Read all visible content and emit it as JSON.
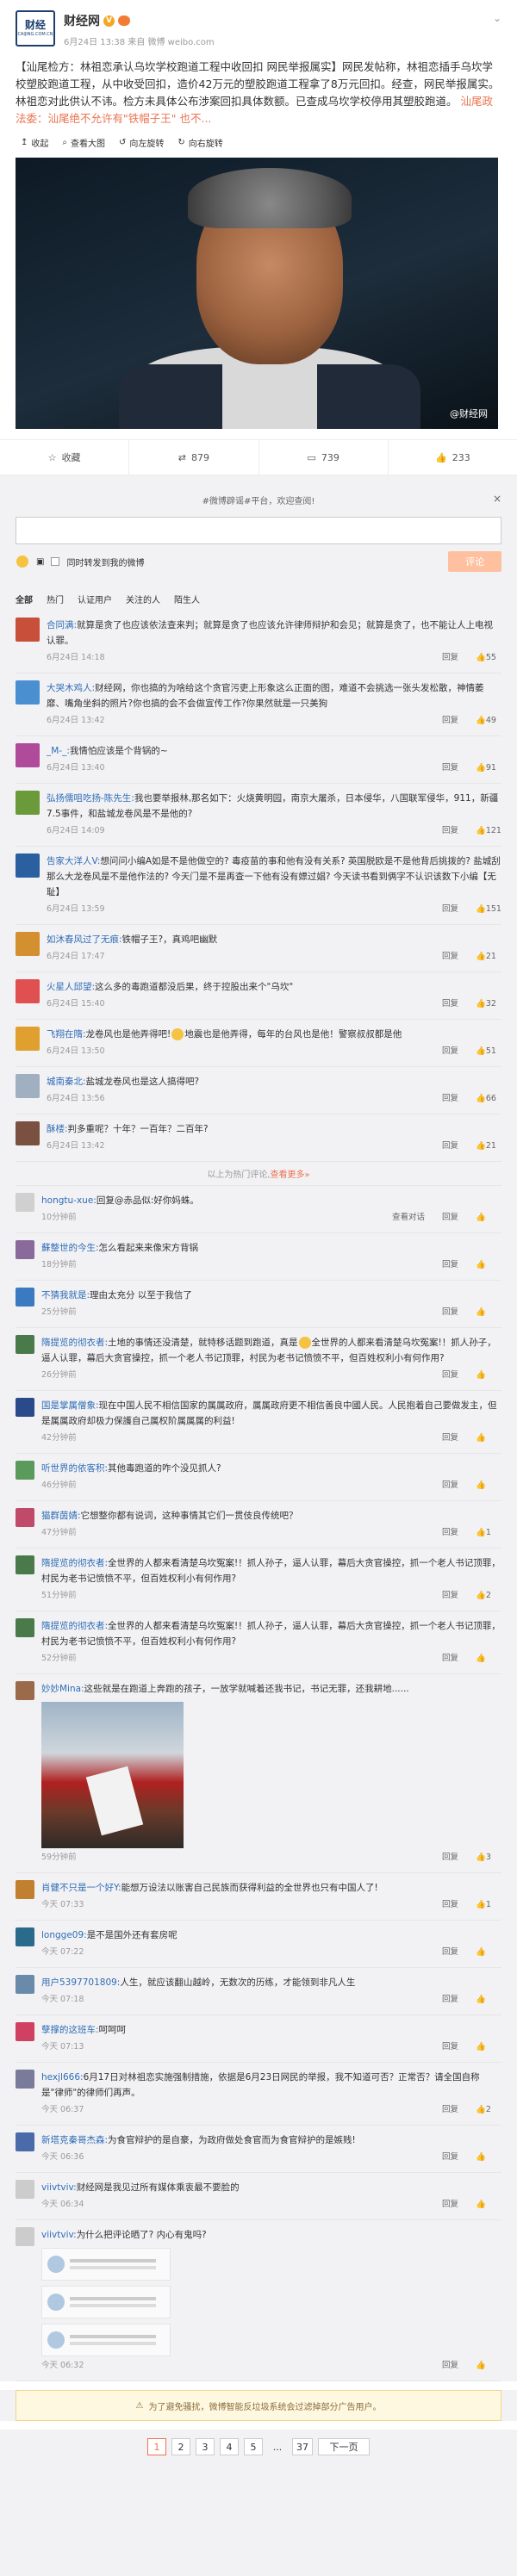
{
  "post": {
    "author": "财经网",
    "logo_line1": "财经",
    "logo_line2": "CAIJING.COM.CN",
    "time": "6月24日 13:38",
    "source": "来自 微博 weibo.com",
    "text_tag": "【汕尾检方：林祖恋承认乌坎学校跑道工程中收回扣 网民举报属实】",
    "text_body": "网民发帖称，林祖恋插手乌坎学校塑胶跑道工程，从中收受回扣，造价42万元的塑胶跑道工程拿了8万元回扣。经查，网民举报属实。林祖恋对此供认不讳。检方未具体公布涉案回扣具体数额。已查成乌坎学校停用其塑胶跑道。",
    "text_link": "汕尾政法委：汕尾绝不允许有\"铁帽子王\"  也不...",
    "tools": [
      "收起",
      "查看大图",
      "向左旋转",
      "向右旋转"
    ],
    "watermark": "@财经网",
    "actions": {
      "favorite": "收藏",
      "repost": "879",
      "comment": "739",
      "like": "233"
    }
  },
  "composer": {
    "hint": "#微博辟谣#平台，欢迎查阅!",
    "also_repost": "同时转发到我的微博",
    "submit": "评论"
  },
  "filter_tabs": [
    "全部",
    "热门",
    "认证用户",
    "关注的人",
    "陌生人"
  ],
  "comments": [
    {
      "name": "合同满:",
      "text": "就算是贪了也应该依法查来判；就算是贪了也应该允许律师辩护和会见；就算是贪了，也不能让人上电视 认罪。",
      "time": "6月24日 14:18",
      "likes": "55",
      "color": "#c8503a"
    },
    {
      "name": "大哭木鸡人:",
      "text": "财经网，你也搞的为啥给这个贪官污吏上形象这么正面的图，难道不会挑选一张头发松散，神情萎靡、嘴角坐斜的照片?你也搞的会不会做宣传工作?你果然就是一只美狗",
      "time": "6月24日 13:42",
      "likes": "49",
      "color": "#4a8fd0"
    },
    {
      "name": "_M-_:",
      "text": "我情怕应该是个背锅的~",
      "time": "6月24日 13:40",
      "likes": "91",
      "color": "#b04a9a"
    },
    {
      "name": "弘扬儒咀吃扬-陈先生:",
      "text": "我也要举报林,那名如下：火烧黄明园，南京大屠杀，日本侵华，八国联军侵华，911，新疆7.5事件，和盐城龙卷风是不是他的?",
      "time": "6月24日 14:09",
      "likes": "121",
      "color": "#6a9a3a"
    },
    {
      "name": "告家大洋人V:",
      "text": "想问问小编A如是不是他做空的? 毒疫苗的事和他有没有关系? 英国脱欧是不是他背后挑拨的? 盐城刮那么大龙卷风是不是他作法的? 今天门是不是再查一下他有没有嫖过娼? 今天读书看到俩字不认识该数下小编【无耻】",
      "time": "6月24日 13:59",
      "likes": "151",
      "color": "#2a5fa0"
    },
    {
      "name": "如沐春风过了无痕:",
      "text": "铁帽子王?，真鸡吧幽默",
      "time": "6月24日 17:47",
      "likes": "21",
      "color": "#d49030"
    },
    {
      "name": "火星人邱望:",
      "text": "这么多的毒跑道都没后果，终于控股出来个\"乌坎\"",
      "time": "6月24日 15:40",
      "likes": "32",
      "color": "#e05050"
    },
    {
      "name": "飞翔在隋:",
      "text": "龙卷风也是他弄得吧!",
      "text2": "地震也是他弄得，每年的台风也是他！警察叔叔都是他",
      "time": "6月24日 13:50",
      "likes": "51",
      "color": "#e0a030"
    },
    {
      "name": "城南秦北:",
      "text": "盐城龙卷风也是这人搞得吧?",
      "time": "6月24日 13:56",
      "likes": "66",
      "color": "#a0b0c0"
    },
    {
      "name": "酥楼:",
      "text": "判多重呢？十年？一百年？二百年?",
      "time": "6月24日 13:42",
      "likes": "21",
      "color": "#7a5040"
    }
  ],
  "more_hot": "以上为热门评论,",
  "more_hot_link": "查看更多»",
  "sub_comments": [
    {
      "name": "hongtu-xue:",
      "text": "回复@赤品似:好你妈蛛。",
      "time": "10分钟前",
      "extra": "查看对话",
      "likes": "",
      "color": "#d0d0d0"
    },
    {
      "name": "蘇整世的今生:",
      "text": "怎么看起来来像宋方背锅",
      "time": "18分钟前",
      "likes": "",
      "color": "#8a6a9a"
    },
    {
      "name": "不猜我就是:",
      "text": "理由太充分 以至于我信了",
      "time": "25分钟前",
      "likes": "",
      "color": "#3a7ac0"
    },
    {
      "name": "隋提览的彻衣者:",
      "text": "土地的事情还没清楚，就特移话题到跑道，真是",
      "text2": "全世界的人都来看清楚乌坎冤案!！抓人孙子，逼人认罪，幕后大贪官操控，抓一个老人书记顶罪，村民为老书记愤愤不平，但百姓权利小有何作用?",
      "time": "26分钟前",
      "likes": "",
      "color": "#4a7a4a"
    },
    {
      "name": "国是掌属僧象:",
      "text": "现在中国人民不相信国家的属属政府，属属政府更不相信善良中國人民。人民抱着自己要做发主，但是属属政府却极力保護自己属权阶属属属的利益!",
      "time": "42分钟前",
      "likes": "",
      "color": "#2a4a8a"
    },
    {
      "name": "听世界的依客积:",
      "text": "其他毒跑道的咋个没见抓人?",
      "time": "46分钟前",
      "likes": "",
      "color": "#5a9a5a"
    },
    {
      "name": "猫群茵婧:",
      "text": "它想整你都有说词，这种事情其它们一贯伎良传统吧？",
      "time": "47分钟前",
      "likes": "1",
      "color": "#c04a6a"
    },
    {
      "name": "隋提览的彻衣者:",
      "text": "全世界的人都来看清楚乌坎冤案!！抓人孙子，逼人认罪，幕后大贪官操控，抓一个老人书记顶罪，村民为老书记愤愤不平，但百姓权利小有何作用?",
      "time": "51分钟前",
      "likes": "2",
      "color": "#4a7a4a"
    },
    {
      "name": "隋提览的彻衣者:",
      "text": "全世界的人都来看清楚乌坎冤案!！抓人孙子，逼人认罪，幕后大贪官操控，抓一个老人书记顶罪，村民为老书记愤愤不平，但百姓权利小有何作用?",
      "time": "52分钟前",
      "likes": "",
      "color": "#4a7a4a"
    },
    {
      "name": "妙妙Mina:",
      "text": "这些就是在跑道上奔跑的孩子，一放学就喊着还我书记，书记无罪，还我耕地......",
      "time": "59分钟前",
      "likes": "3",
      "color": "#9a6a4a",
      "photo": true
    },
    {
      "name": "肖健不只是一个好Y:",
      "text": "能想万设法以账害自己民族而获得利益的全世界也只有中国人了!",
      "time": "今天 07:33",
      "likes": "1",
      "color": "#c08030"
    },
    {
      "name": "longge09:",
      "text": "是不是国外还有套房呢",
      "time": "今天 07:22",
      "likes": "",
      "color": "#2a6a8a"
    },
    {
      "name": "用户5397701809:",
      "text": "人生，就应该翻山越岭，无数次的历练，才能领到非凡人生",
      "time": "今天 07:18",
      "likes": "",
      "color": "#6a8aaa"
    },
    {
      "name": "孽撑的这班车:",
      "text": "呵呵呵",
      "time": "今天 07:13",
      "likes": "",
      "color": "#d04060"
    },
    {
      "name": "hexjl666:",
      "text": "6月17日对林祖恋实施强制措施，依据是6月23日网民的举报，我不知道可否？正常否？请全国自称是\"律师\"的律师们再声。",
      "time": "今天 06:37",
      "likes": "2",
      "color": "#7a7a9a"
    },
    {
      "name": "新塔克秦哥杰森:",
      "text": "为食官辩护的是自豪，为政府做处食官而为食官辩护的是嫉贱!",
      "time": "今天 06:36",
      "likes": "",
      "color": "#4a6aaa"
    },
    {
      "name": "viivtviv:",
      "text": "财经网是我见过所有媒体乘衷最不要脸的",
      "time": "今天 06:34",
      "likes": "",
      "color": "#cccccc"
    },
    {
      "name": "viivtviv:",
      "text": "为什么把评论晒了? 内心有鬼吗?",
      "time": "今天 06:32",
      "likes": "",
      "color": "#cccccc",
      "shots": true
    }
  ],
  "reply_label": "回复",
  "ad_notice": "为了避免骚扰，微博智能反垃圾系统会过滤掉部分广告用户。",
  "pager": {
    "pages": [
      "1",
      "2",
      "3",
      "4",
      "5",
      "...",
      "37"
    ],
    "next": "下一页",
    "current": "1"
  }
}
